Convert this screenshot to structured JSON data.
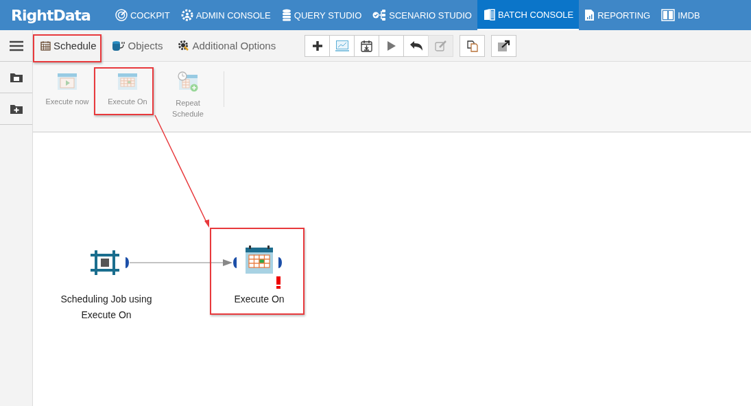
{
  "app": {
    "logo": "RightData"
  },
  "nav": [
    {
      "label": "COCKPIT",
      "selected": false
    },
    {
      "label": "ADMIN CONSOLE",
      "selected": false
    },
    {
      "label": "QUERY STUDIO",
      "selected": false
    },
    {
      "label": "SCENARIO STUDIO",
      "selected": false
    },
    {
      "label": "BATCH CONSOLE",
      "selected": true
    },
    {
      "label": "REPORTING",
      "selected": false
    },
    {
      "label": "IMDB",
      "selected": false
    }
  ],
  "tabs": [
    {
      "label": "Schedule",
      "selected": true
    },
    {
      "label": "Objects",
      "selected": false
    },
    {
      "label": "Additional Options",
      "selected": false
    }
  ],
  "toolbar_groups": [
    [
      {
        "disabled": false
      },
      {
        "disabled": false
      },
      {
        "disabled": false
      },
      {
        "disabled": false
      },
      {
        "disabled": false
      },
      {
        "disabled": true
      }
    ],
    [
      {
        "disabled": false
      }
    ],
    [
      {
        "disabled": false
      }
    ]
  ],
  "ribbon": [
    {
      "label": "Execute now",
      "disabled": true
    },
    {
      "label": "Execute On",
      "disabled": true
    },
    {
      "label": "Repeat Schedule",
      "disabled": true
    }
  ],
  "canvas": {
    "nodes": [
      {
        "label": "Scheduling Job using Execute On",
        "kind": "job",
        "warning": false
      },
      {
        "label": "Execute On",
        "kind": "execute-on",
        "warning": true
      }
    ]
  }
}
